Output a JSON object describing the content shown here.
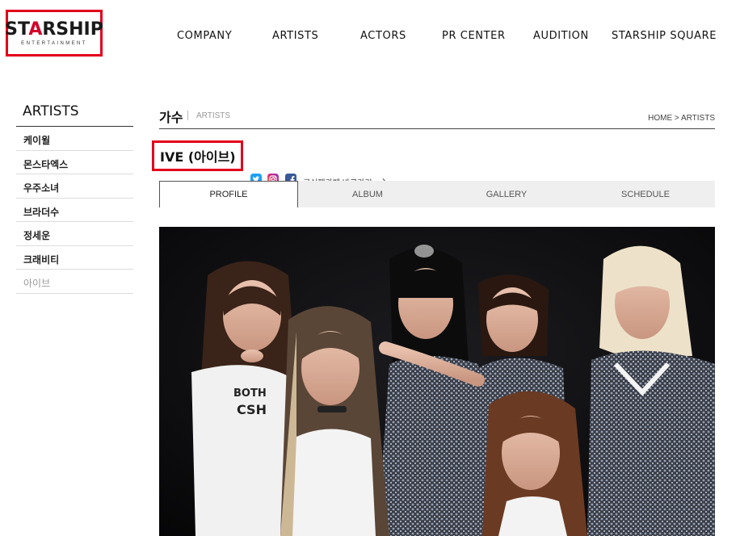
{
  "logo": {
    "text_pre": "ST",
    "text_accent": "A",
    "text_post": "RSHIP",
    "sub": "ENTERTAINMENT"
  },
  "nav": [
    "COMPANY",
    "ARTISTS",
    "ACTORS",
    "PR CENTER",
    "AUDITION",
    "STARSHIP SQUARE"
  ],
  "sidebar": {
    "title": "ARTISTS",
    "items": [
      "케이윌",
      "몬스타엑스",
      "우주소녀",
      "브라더수",
      "정세운",
      "크래비티",
      "아이브"
    ]
  },
  "page": {
    "title": "가수",
    "subtitle": "ARTISTS",
    "breadcrumb": "HOME > ARTISTS"
  },
  "artist": {
    "name": "IVE (아이브)",
    "cafe_label": "공식팬카페 바로가기",
    "cafe_chevron": "›"
  },
  "tabs": [
    "PROFILE",
    "ALBUM",
    "GALLERY",
    "SCHEDULE"
  ],
  "photo_shirt_text": "BOTH\nCSH",
  "colors": {
    "brand_red": "#d4002a",
    "highlight_red": "#e2001a",
    "twitter": "#1da1f2",
    "instagram": "#d6297a",
    "facebook": "#3b5998"
  }
}
